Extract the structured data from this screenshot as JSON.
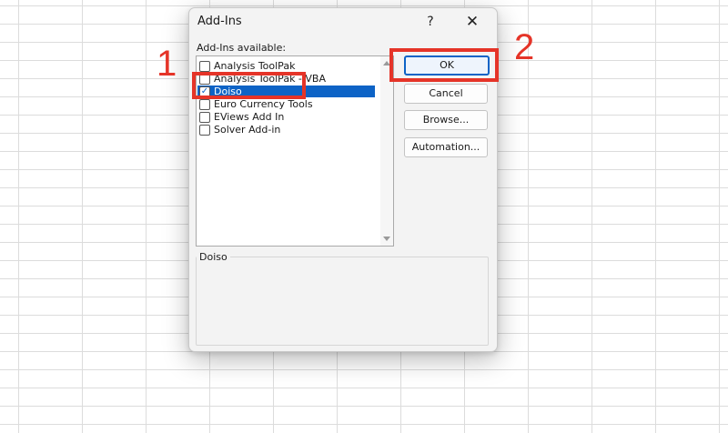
{
  "dialog": {
    "title": "Add-Ins",
    "help_label": "?",
    "close_label": "✕",
    "list_caption": "Add-Ins available:",
    "items": [
      {
        "label": "Analysis ToolPak",
        "checked": false
      },
      {
        "label": "Analysis ToolPak - VBA",
        "checked": false
      },
      {
        "label": "Doiso",
        "checked": true
      },
      {
        "label": "Euro Currency Tools",
        "checked": false
      },
      {
        "label": "EViews Add In",
        "checked": false
      },
      {
        "label": "Solver Add-in",
        "checked": false
      }
    ],
    "selected_index": 2,
    "description_title": "Doiso",
    "buttons": {
      "ok": "OK",
      "cancel": "Cancel",
      "browse": "Browse...",
      "automation": "Automation..."
    }
  },
  "annotations": {
    "step1": "1",
    "step2": "2"
  },
  "colors": {
    "selection": "#0d63c6",
    "annotation_red": "#e53428"
  }
}
